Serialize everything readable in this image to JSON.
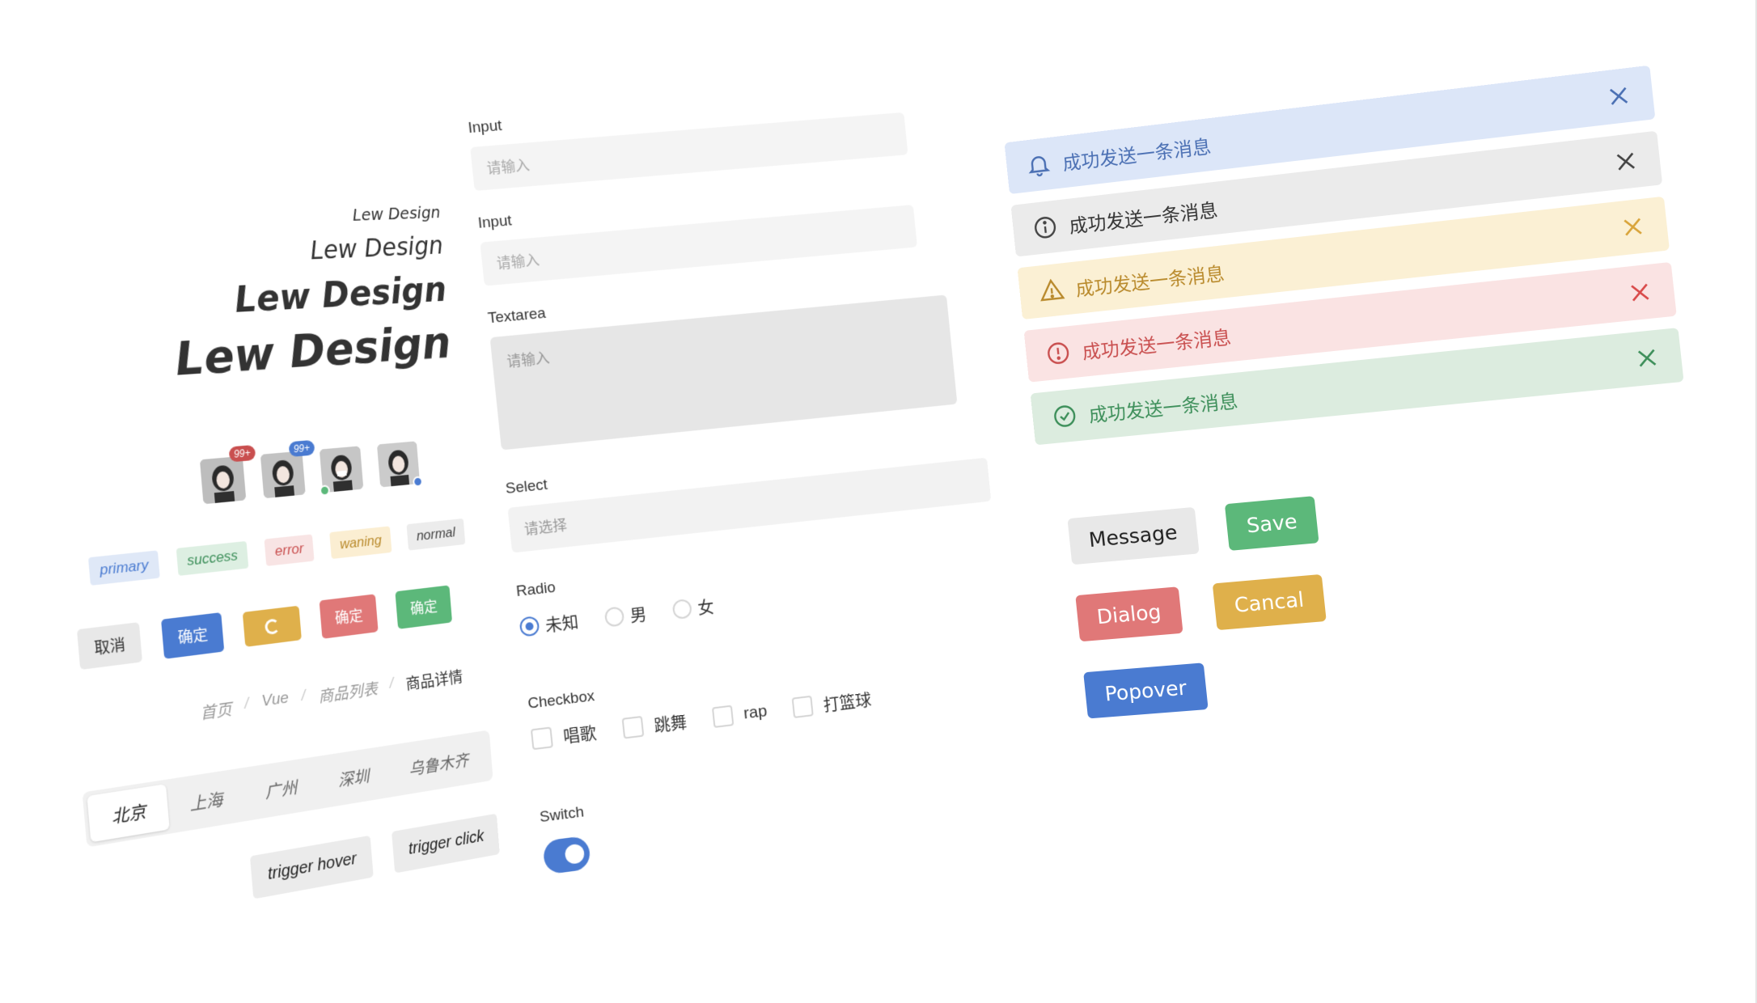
{
  "colors": {
    "primary": "#4a7bd1",
    "success": "#5cb87a",
    "error": "#e07878",
    "warning": "#dfb04b",
    "normal": "#e8e8e8"
  },
  "left": {
    "title_1": "Lew Design",
    "title_2": "Lew Design",
    "title_3": "Lew Design",
    "title_4": "Lew Design",
    "avatars": [
      {
        "badge": "99+"
      },
      {
        "badge": "99+"
      },
      {
        "badge": ""
      },
      {
        "badge": ""
      }
    ],
    "tags": {
      "primary": "primary",
      "success": "success",
      "error": "error",
      "warning": "waning",
      "normal": "normal"
    },
    "buttons": {
      "cancel": "取消",
      "confirm_primary": "确定",
      "confirm_error": "确定",
      "confirm_success": "确定"
    },
    "breadcrumb": {
      "home": "首页",
      "vue": "Vue",
      "list": "商品列表",
      "detail": "商品详情",
      "separator": "/"
    },
    "tabs": [
      "北京",
      "上海",
      "广州",
      "深圳",
      "乌鲁木齐"
    ],
    "triggers": {
      "hover": "trigger hover",
      "click": "trigger click"
    }
  },
  "form": {
    "input1": {
      "label": "Input",
      "placeholder": "请输入"
    },
    "input2": {
      "label": "Input",
      "placeholder": "请输入"
    },
    "textarea": {
      "label": "Textarea",
      "placeholder": "请输入"
    },
    "select": {
      "label": "Select",
      "placeholder": "请选择"
    },
    "radio": {
      "label": "Radio",
      "options": [
        "未知",
        "男",
        "女"
      ],
      "selected": "未知"
    },
    "checkbox": {
      "label": "Checkbox",
      "options": [
        "唱歌",
        "跳舞",
        "rap",
        "打篮球"
      ]
    },
    "switch": {
      "label": "Switch",
      "on": true
    }
  },
  "right": {
    "alerts": [
      {
        "type": "primary",
        "text": "成功发送一条消息",
        "icon": "bell-icon"
      },
      {
        "type": "normal",
        "text": "成功发送一条消息",
        "icon": "info-icon"
      },
      {
        "type": "warning",
        "text": "成功发送一条消息",
        "icon": "warning-icon"
      },
      {
        "type": "error",
        "text": "成功发送一条消息",
        "icon": "error-icon"
      },
      {
        "type": "success",
        "text": "成功发送一条消息",
        "icon": "success-icon"
      }
    ],
    "buttons": {
      "message": "Message",
      "save": "Save",
      "dialog": "Dialog",
      "cancal": "Cancal",
      "popover": "Popover"
    }
  }
}
